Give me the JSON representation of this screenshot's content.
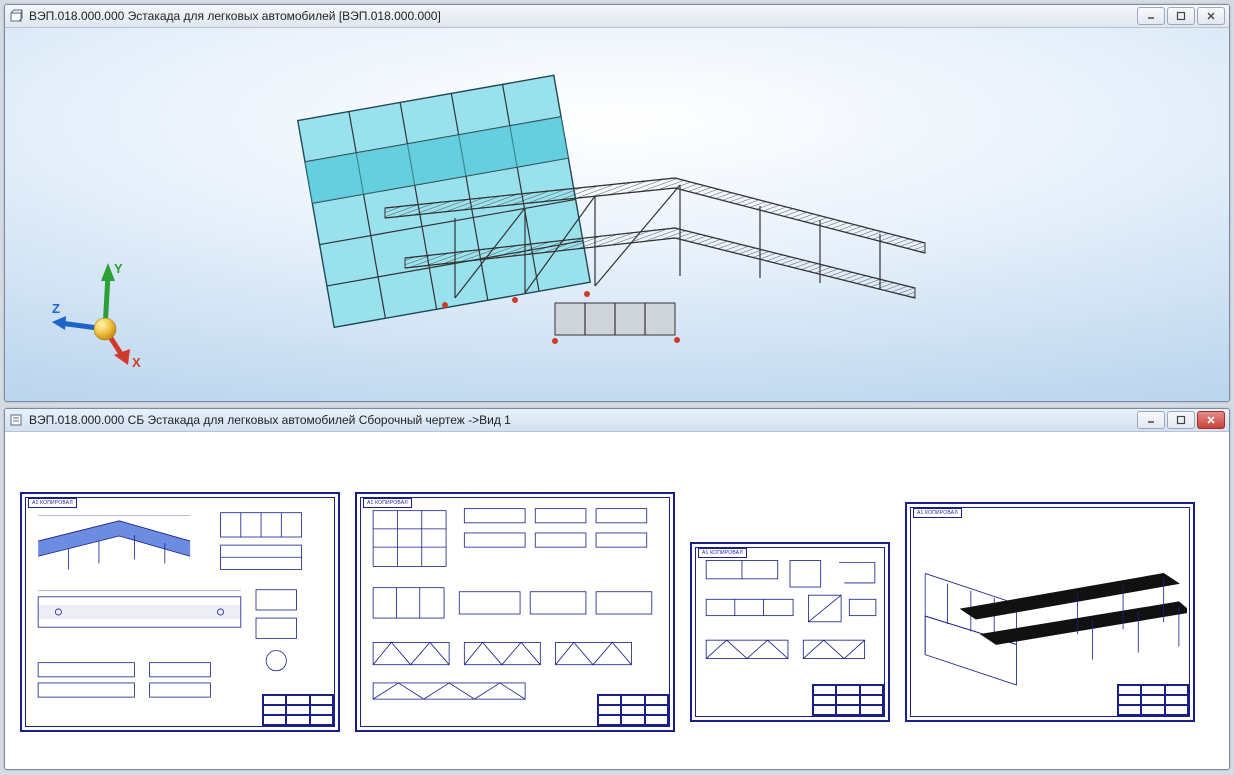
{
  "windows": {
    "model": {
      "title": "ВЭП.018.000.000 Эстакада для легковых автомобилей [ВЭП.018.000.000]",
      "icon": "document-3d-icon",
      "axes": {
        "x": "X",
        "y": "Y",
        "z": "Z"
      }
    },
    "drawing": {
      "title": "ВЭП.018.000.000 СБ Эстакада для легковых автомобилей Сборочный чертеж ->Вид 1",
      "icon": "document-drawing-icon",
      "sheets": [
        {
          "label": "А1 КОПИРОВАЛ"
        },
        {
          "label": "А1 КОПИРОВАЛ"
        },
        {
          "label": "А1 КОПИРОВАЛ"
        },
        {
          "label": "А1 КОПИРОВАЛ"
        }
      ]
    }
  },
  "buttons": {
    "minimize": "Minimize",
    "maximize": "Maximize",
    "close": "Close"
  }
}
